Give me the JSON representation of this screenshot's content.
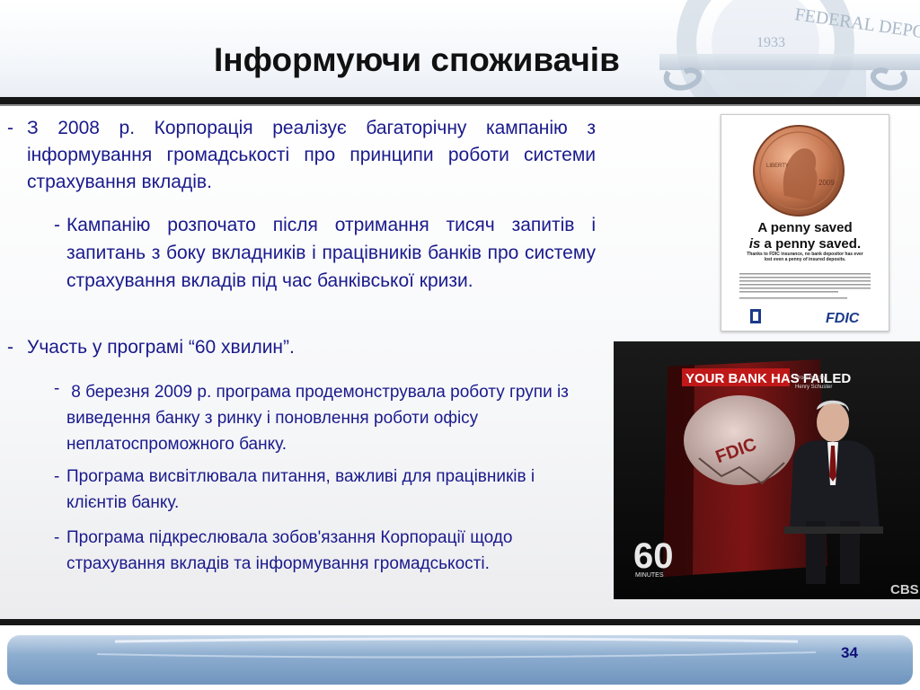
{
  "slide": {
    "title": "Інформуючи споживачів",
    "page_number": "34"
  },
  "bullets": {
    "b1": {
      "dash": "-",
      "text": "З 2008 р. Корпорація реалізує багаторічну кампанію з інформування громадськості  про принципи роботи системи страхування вкладів."
    },
    "b1_sub": {
      "dash": "-",
      "text": "Кампанію розпочато після отримання тисяч запитів і запитань з боку вкладників і працівників банків про систему страхування вкладів під час банківської кризи."
    },
    "b2": {
      "dash": "-",
      "text": "Участь у програмі “60 хвилин”."
    },
    "b2_sub": [
      {
        "dash": "-",
        "text": " 8 березня 2009 р. програма продемонструвала роботу групи із виведення банку з ринку і поновлення роботи офісу неплатоспроможного банку."
      },
      {
        "dash": "-",
        "text": "Програма висвітлювала питання, важливі для працівників і клієнтів банку."
      },
      {
        "dash": "-",
        "text": "Програма підкреслювала зобов'язання Корпорації щодо страхування вкладів та інформування громадськості."
      }
    ]
  },
  "poster": {
    "coin_year": "2009",
    "coin_liberty": "LIBERTY",
    "headline_line1": "A penny saved",
    "headline_line2_em": "is",
    "headline_line2_rest": " a penny saved.",
    "subhead": "Thanks to FDIC insurance, no bank depositor has ever lost even a penny of insured deposits.",
    "brand": "FDIC"
  },
  "video": {
    "banner_text": "YOUR BANK HAS FAILED",
    "produced_by": "Produced By",
    "producer": "Henry Schuster",
    "piggy_label": "FDIC",
    "logo_number": "60",
    "logo_word": "MINUTES",
    "network": "CBS"
  },
  "seal": {
    "arc_text": "FEDERAL DEPO",
    "year": "1933"
  },
  "colors": {
    "text_blue": "#1a1a8c",
    "title": "#111111",
    "rule": "#161616"
  }
}
